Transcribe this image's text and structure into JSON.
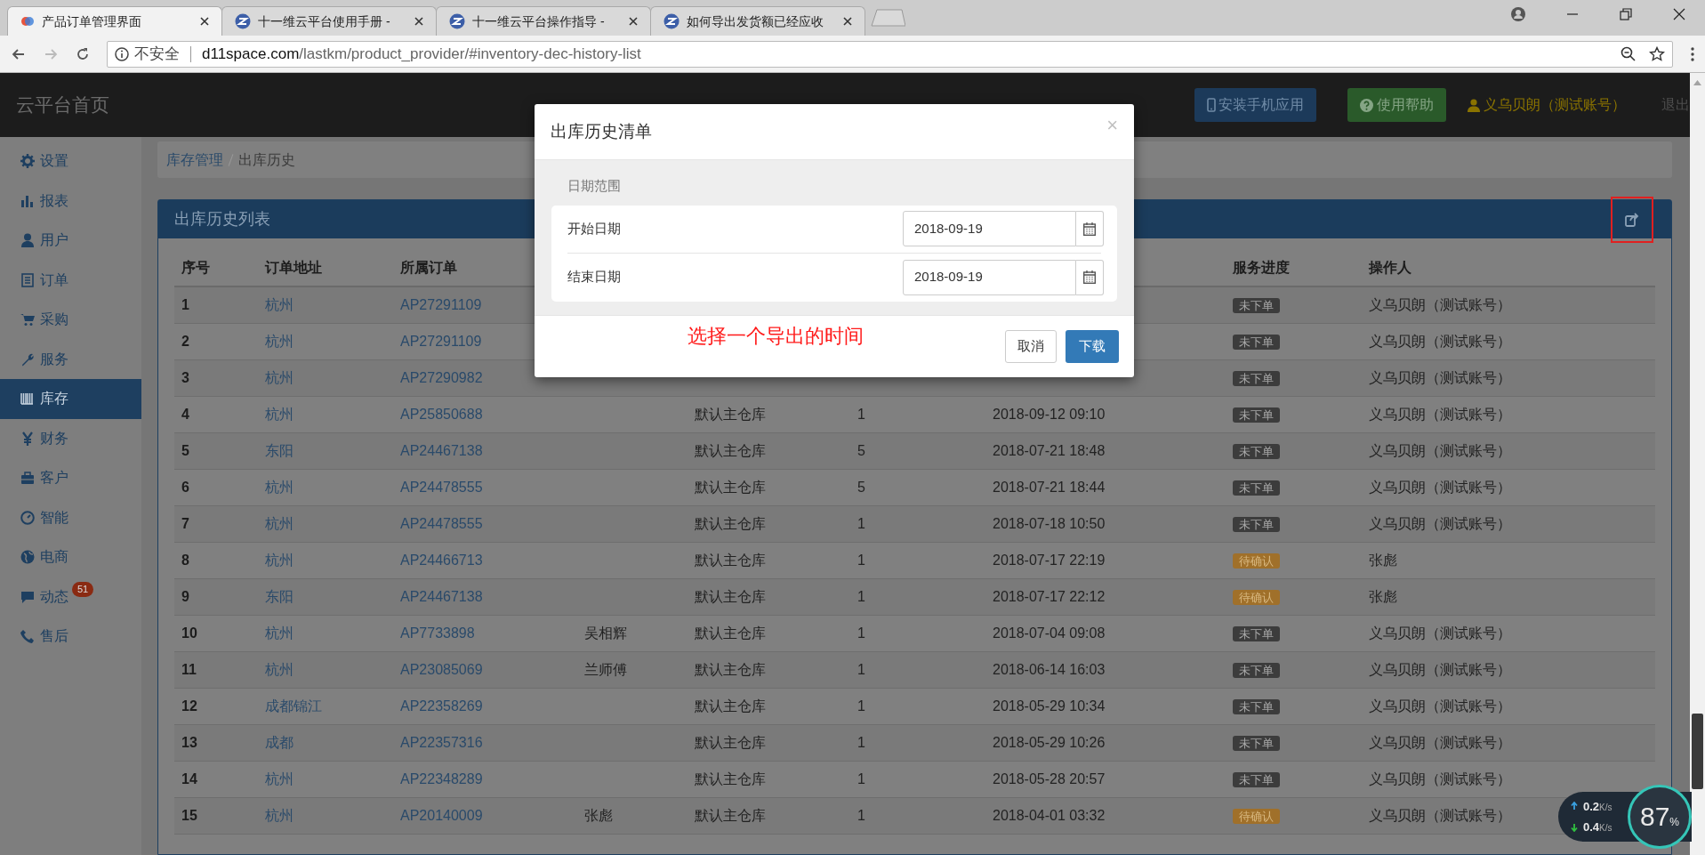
{
  "browser": {
    "tabs": [
      {
        "title": "产品订单管理界面",
        "selected": true
      },
      {
        "title": "十一维云平台使用手册 - ",
        "selected": false
      },
      {
        "title": "十一维云平台操作指导 - ",
        "selected": false
      },
      {
        "title": "如何导出发货额已经应收",
        "selected": false
      }
    ],
    "security": "不安全",
    "url_host": "d11space.com",
    "url_path": "/lastkm/product_provider/#inventory-dec-history-list"
  },
  "header": {
    "brand": "云平台首页",
    "install_button": "安装手机应用",
    "help_button": "使用帮助",
    "user": "义乌贝朗（测试账号）",
    "logout": "退出"
  },
  "sidebar": {
    "items": [
      {
        "label": "设置",
        "selected": false
      },
      {
        "label": "报表",
        "selected": false
      },
      {
        "label": "用户",
        "selected": false
      },
      {
        "label": "订单",
        "selected": false
      },
      {
        "label": "采购",
        "selected": false
      },
      {
        "label": "服务",
        "selected": false
      },
      {
        "label": "库存",
        "selected": true
      },
      {
        "label": "财务",
        "selected": false
      },
      {
        "label": "客户",
        "selected": false
      },
      {
        "label": "智能",
        "selected": false
      },
      {
        "label": "电商",
        "selected": false
      },
      {
        "label": "动态",
        "selected": false,
        "badge": "51"
      },
      {
        "label": "售后",
        "selected": false
      }
    ]
  },
  "breadcrumb": [
    "库存管理",
    "出库历史"
  ],
  "panel": {
    "title": "出库历史列表"
  },
  "table": {
    "columns": {
      "index": "序号",
      "address": "订单地址",
      "order": "所属订单",
      "status": "服务进度",
      "operator": "操作人"
    },
    "rows": [
      {
        "index": "1",
        "address": "杭州",
        "order": "AP27291109",
        "status": {
          "text": "未下单",
          "kind": "unordered"
        },
        "operator": "义乌贝朗（测试账号）"
      },
      {
        "index": "2",
        "address": "杭州",
        "order": "AP27291109",
        "status": {
          "text": "未下单",
          "kind": "unordered"
        },
        "operator": "义乌贝朗（测试账号）"
      },
      {
        "index": "3",
        "address": "杭州",
        "order": "AP27290982",
        "status": {
          "text": "未下单",
          "kind": "unordered"
        },
        "operator": "义乌贝朗（测试账号）"
      },
      {
        "index": "4",
        "address": "杭州",
        "order": "AP25850688",
        "column_5": "默认主仓库",
        "column_6": "1",
        "column_7": "2018-09-12 09:10",
        "status": {
          "text": "未下单",
          "kind": "unordered"
        },
        "operator": "义乌贝朗（测试账号）"
      },
      {
        "index": "5",
        "address": "东阳",
        "order": "AP24467138",
        "column_5": "默认主仓库",
        "column_6": "5",
        "column_7": "2018-07-21 18:48",
        "status": {
          "text": "未下单",
          "kind": "unordered"
        },
        "operator": "义乌贝朗（测试账号）"
      },
      {
        "index": "6",
        "address": "杭州",
        "order": "AP24478555",
        "column_5": "默认主仓库",
        "column_6": "5",
        "column_7": "2018-07-21 18:44",
        "status": {
          "text": "未下单",
          "kind": "unordered"
        },
        "operator": "义乌贝朗（测试账号）"
      },
      {
        "index": "7",
        "address": "杭州",
        "order": "AP24478555",
        "column_5": "默认主仓库",
        "column_6": "1",
        "column_7": "2018-07-18 10:50",
        "status": {
          "text": "未下单",
          "kind": "unordered"
        },
        "operator": "义乌贝朗（测试账号）"
      },
      {
        "index": "8",
        "address": "杭州",
        "order": "AP24466713",
        "column_5": "默认主仓库",
        "column_6": "1",
        "column_7": "2018-07-17 22:19",
        "status": {
          "text": "待确认",
          "kind": "pending"
        },
        "operator": "张彪"
      },
      {
        "index": "9",
        "address": "东阳",
        "order": "AP24467138",
        "column_5": "默认主仓库",
        "column_6": "1",
        "column_7": "2018-07-17 22:12",
        "status": {
          "text": "待确认",
          "kind": "pending"
        },
        "operator": "张彪"
      },
      {
        "index": "10",
        "address": "杭州",
        "order": "AP7733898",
        "column_4": "吴相辉",
        "column_5": "默认主仓库",
        "column_6": "1",
        "column_7": "2018-07-04 09:08",
        "status": {
          "text": "未下单",
          "kind": "unordered"
        },
        "operator": "义乌贝朗（测试账号）"
      },
      {
        "index": "11",
        "address": "杭州",
        "order": "AP23085069",
        "column_4": "兰师傅",
        "column_5": "默认主仓库",
        "column_6": "1",
        "column_7": "2018-06-14 16:03",
        "status": {
          "text": "未下单",
          "kind": "unordered"
        },
        "operator": "义乌贝朗（测试账号）"
      },
      {
        "index": "12",
        "address": "成都锦江",
        "order": "AP22358269",
        "column_5": "默认主仓库",
        "column_6": "1",
        "column_7": "2018-05-29 10:34",
        "status": {
          "text": "未下单",
          "kind": "unordered"
        },
        "operator": "义乌贝朗（测试账号）"
      },
      {
        "index": "13",
        "address": "成都",
        "order": "AP22357316",
        "column_5": "默认主仓库",
        "column_6": "1",
        "column_7": "2018-05-29 10:26",
        "status": {
          "text": "未下单",
          "kind": "unordered"
        },
        "operator": "义乌贝朗（测试账号）"
      },
      {
        "index": "14",
        "address": "杭州",
        "order": "AP22348289",
        "column_5": "默认主仓库",
        "column_6": "1",
        "column_7": "2018-05-28 20:57",
        "status": {
          "text": "未下单",
          "kind": "unordered"
        },
        "operator": "义乌贝朗（测试账号）"
      },
      {
        "index": "15",
        "address": "杭州",
        "order": "AP20140009",
        "column_4": "张彪",
        "column_5": "默认主仓库",
        "column_6": "1",
        "column_7": "2018-04-01 03:32",
        "status": {
          "text": "待确认",
          "kind": "pending"
        },
        "operator": "义乌贝朗（测试账号）"
      }
    ]
  },
  "modal": {
    "title": "出库历史清单",
    "close": "×",
    "section": "日期范围",
    "fields": [
      {
        "label": "开始日期",
        "value": "2018-09-19"
      },
      {
        "label": "结束日期",
        "value": "2018-09-19"
      }
    ],
    "note": "选择一个导出的时间",
    "cancel": "取消",
    "download": "下载"
  },
  "net_widget": {
    "upload": "0.2",
    "upload_unit": "K/s",
    "download": "0.4",
    "download_unit": "K/s",
    "percent": "87",
    "percent_unit": "%"
  }
}
